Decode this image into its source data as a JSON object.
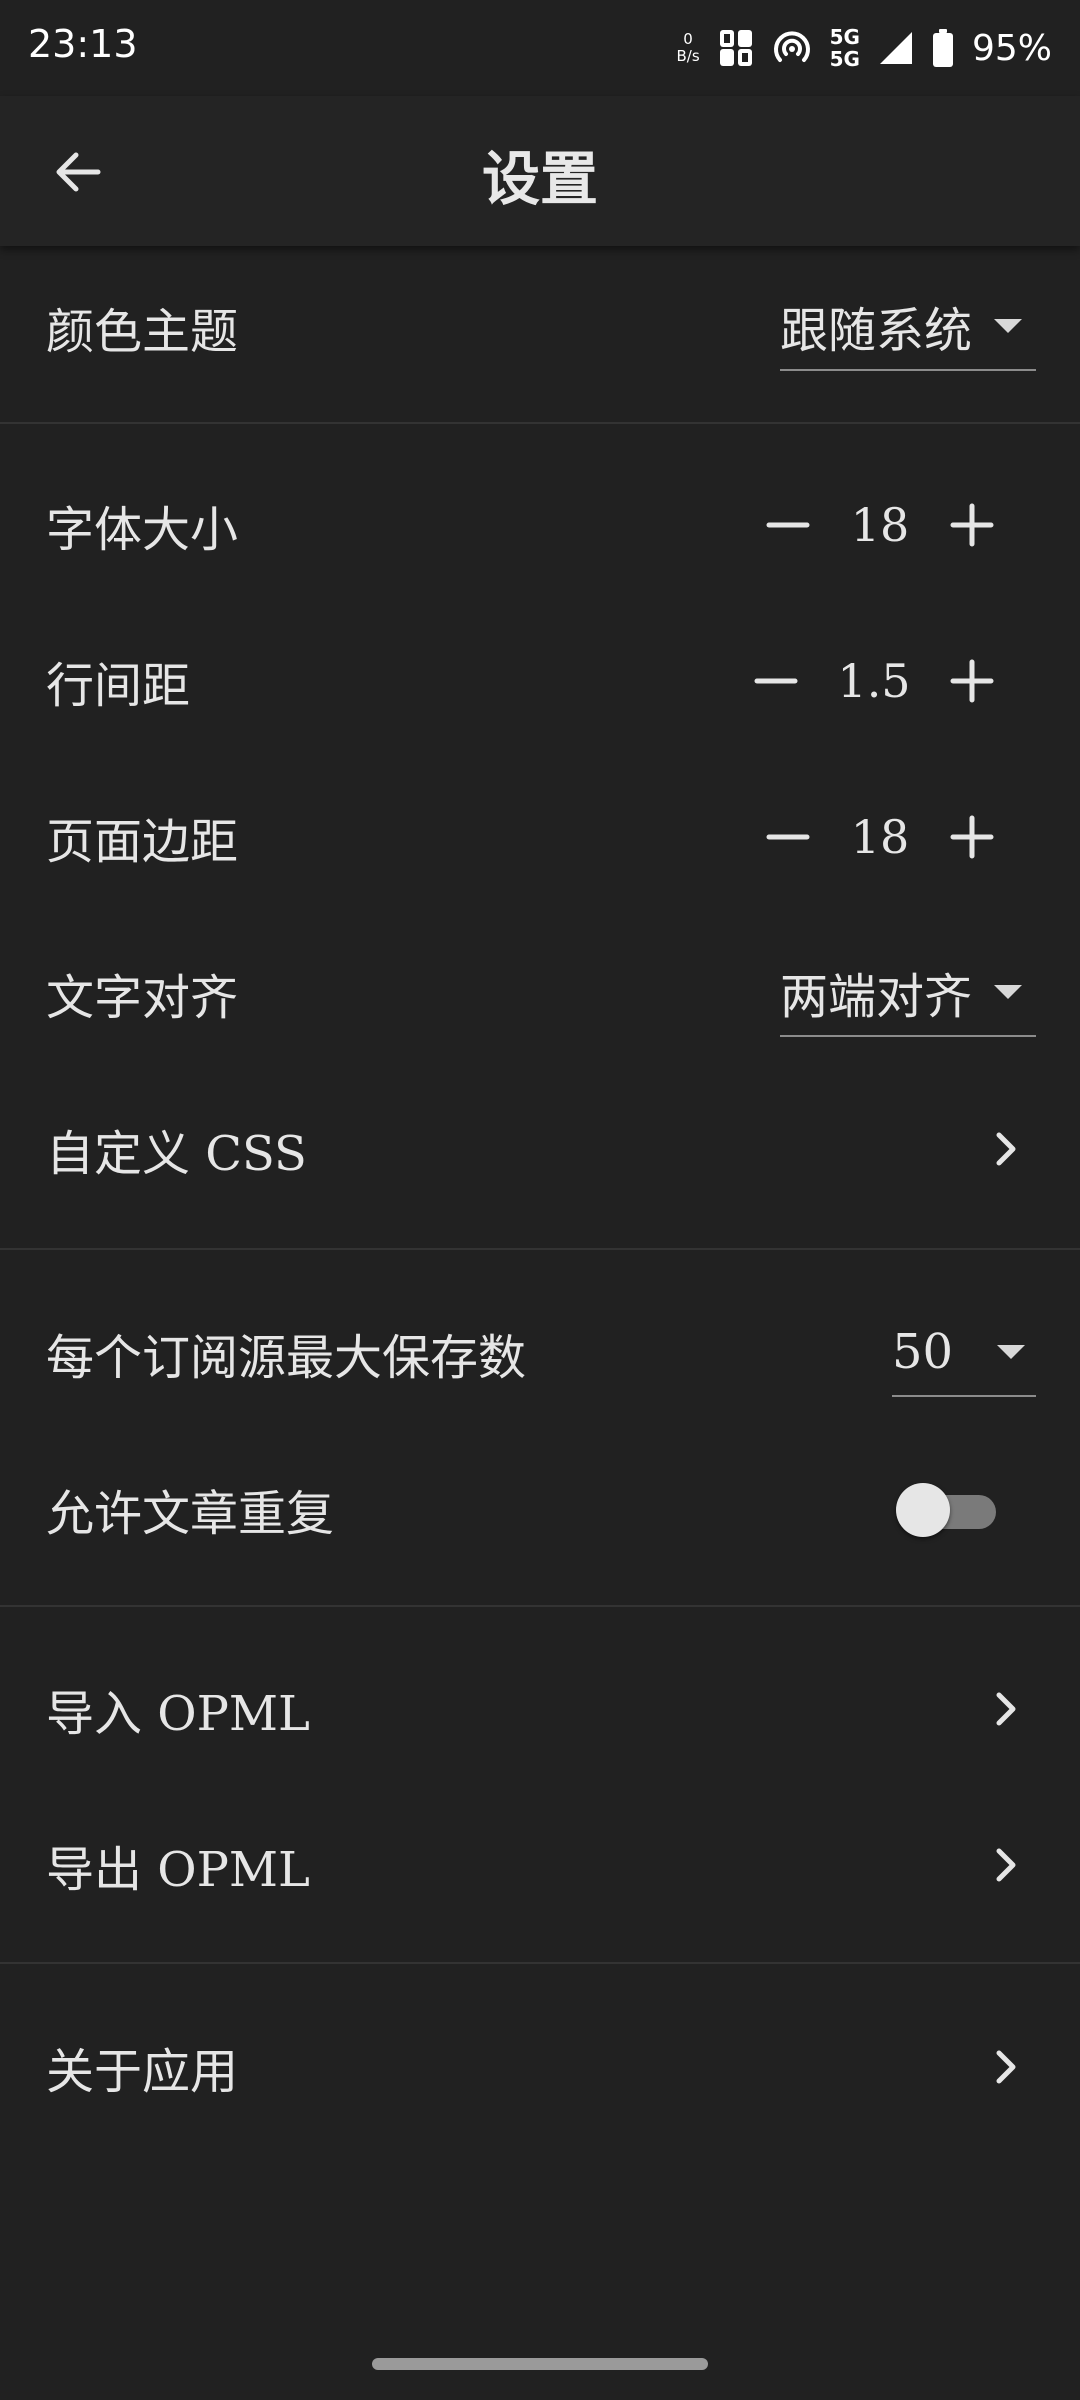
{
  "status_bar": {
    "time": "23:13",
    "net_speed_value": "0",
    "net_speed_unit": "B/s",
    "network_top": "5G",
    "network_bottom": "5G",
    "battery": "95%"
  },
  "app_bar": {
    "title": "设置"
  },
  "settings": {
    "theme": {
      "label": "颜色主题",
      "value": "跟随系统"
    },
    "font_size": {
      "label": "字体大小",
      "value": "18"
    },
    "line_spacing": {
      "label": "行间距",
      "value": "1.5"
    },
    "page_margin": {
      "label": "页面边距",
      "value": "18"
    },
    "text_align": {
      "label": "文字对齐",
      "value": "两端对齐"
    },
    "custom_css": {
      "label": "自定义 CSS"
    },
    "max_saved": {
      "label": "每个订阅源最大保存数",
      "value": "50"
    },
    "allow_duplicate": {
      "label": "允许文章重复",
      "enabled": false
    },
    "import_opml": {
      "label": "导入 OPML"
    },
    "export_opml": {
      "label": "导出 OPML"
    },
    "about": {
      "label": "关于应用"
    }
  },
  "colors": {
    "background": "#212121",
    "app_bar": "#242424",
    "text": "#e6e6e6",
    "divider": "#333333",
    "toggle_track_off": "#7a7a7a"
  }
}
